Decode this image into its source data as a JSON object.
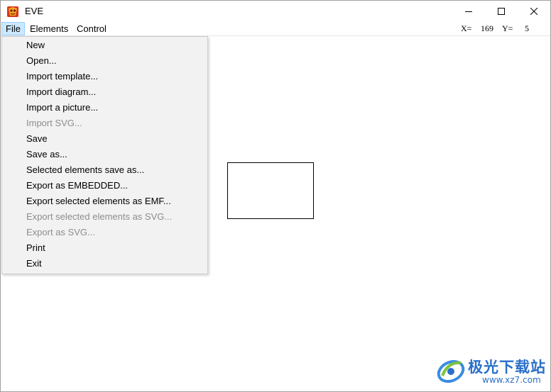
{
  "window": {
    "title": "EVE",
    "icon": "eve-app-icon"
  },
  "menubar": {
    "items": [
      "File",
      "Elements",
      "Control"
    ],
    "active": "File"
  },
  "coords": {
    "x_label": "X=",
    "x_value": "169",
    "y_label": "Y=",
    "y_value": "5"
  },
  "file_menu": {
    "items": [
      {
        "label": "New",
        "enabled": true
      },
      {
        "label": "Open...",
        "enabled": true
      },
      {
        "label": "Import template...",
        "enabled": true
      },
      {
        "label": "Import diagram...",
        "enabled": true
      },
      {
        "label": "Import a picture...",
        "enabled": true
      },
      {
        "label": "Import SVG...",
        "enabled": false
      },
      {
        "label": "Save",
        "enabled": true
      },
      {
        "label": "Save as...",
        "enabled": true
      },
      {
        "label": "Selected elements save as...",
        "enabled": true
      },
      {
        "label": "Export as EMBEDDED...",
        "enabled": true
      },
      {
        "label": "Export selected elements as EMF...",
        "enabled": true
      },
      {
        "label": "Export selected elements as SVG...",
        "enabled": false
      },
      {
        "label": "Export as SVG...",
        "enabled": false
      },
      {
        "label": "Print",
        "enabled": true
      },
      {
        "label": "Exit",
        "enabled": true
      }
    ]
  },
  "watermark": {
    "name": "极光下载站",
    "url": "www.xz7.com",
    "color": "#2a6fc9"
  }
}
